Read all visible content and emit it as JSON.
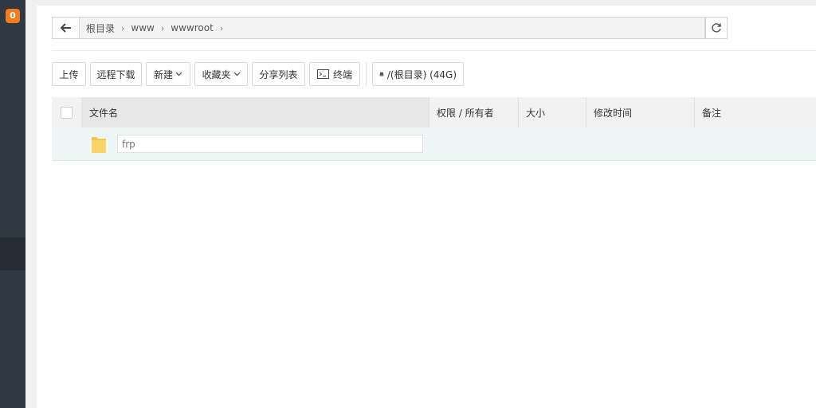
{
  "sidebar": {
    "badge_count": "0"
  },
  "path": {
    "crumbs": [
      {
        "label": "根目录"
      },
      {
        "label": "www"
      },
      {
        "label": "wwwroot"
      }
    ]
  },
  "toolbar": {
    "upload": "上传",
    "remote_download": "远程下载",
    "new": "新建",
    "favorites": "收藏夹",
    "share_list": "分享列表",
    "terminal": "终端",
    "disk": "/(根目录) (44G)"
  },
  "table": {
    "headers": {
      "name": "文件名",
      "permission_owner": "权限 / 所有者",
      "size": "大小",
      "modified": "修改时间",
      "remark": "备注"
    },
    "rows": [
      {
        "name_value": "frp"
      }
    ]
  },
  "colors": {
    "accent_badge": "#f37b1d",
    "sidebar_bg": "#303841",
    "row_highlight": "#eef7f5",
    "folder": "#f5c54a"
  }
}
